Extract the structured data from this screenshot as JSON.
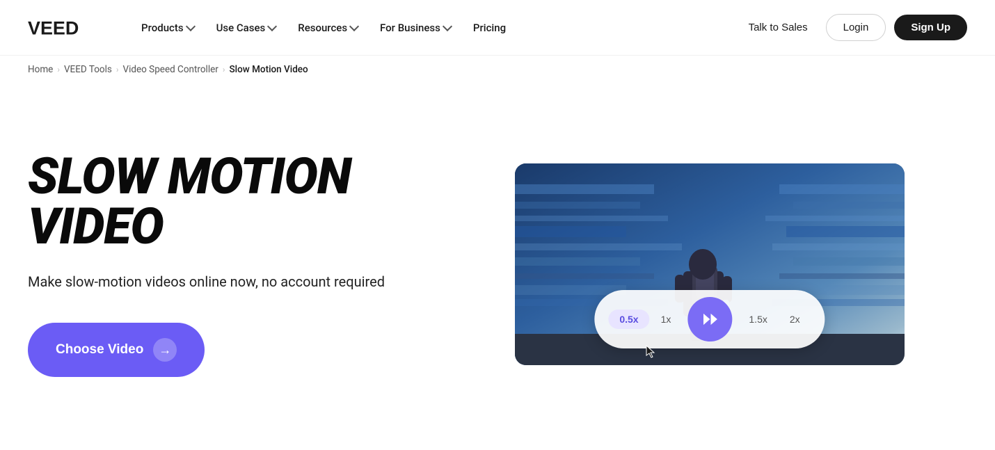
{
  "nav": {
    "logo_text": "VEED",
    "items": [
      {
        "label": "Products",
        "has_dropdown": true
      },
      {
        "label": "Use Cases",
        "has_dropdown": true
      },
      {
        "label": "Resources",
        "has_dropdown": true
      },
      {
        "label": "For Business",
        "has_dropdown": true
      },
      {
        "label": "Pricing",
        "has_dropdown": false
      }
    ],
    "talk_to_sales": "Talk to Sales",
    "login": "Login",
    "sign_up": "Sign Up"
  },
  "breadcrumb": {
    "items": [
      {
        "label": "Home",
        "active": false
      },
      {
        "label": "VEED Tools",
        "active": false
      },
      {
        "label": "Video Speed Controller",
        "active": false
      },
      {
        "label": "Slow Motion Video",
        "active": true
      }
    ]
  },
  "hero": {
    "title": "SLOW MOTION VIDEO",
    "subtitle": "Make slow-motion videos online now, no account required",
    "cta_label": "Choose Video",
    "arrow": "→"
  },
  "video_preview": {
    "speed_options": [
      {
        "label": "0.5x",
        "active": true
      },
      {
        "label": "1x",
        "active": false
      },
      {
        "label": "1.5x",
        "active": false
      },
      {
        "label": "2x",
        "active": false
      }
    ]
  }
}
